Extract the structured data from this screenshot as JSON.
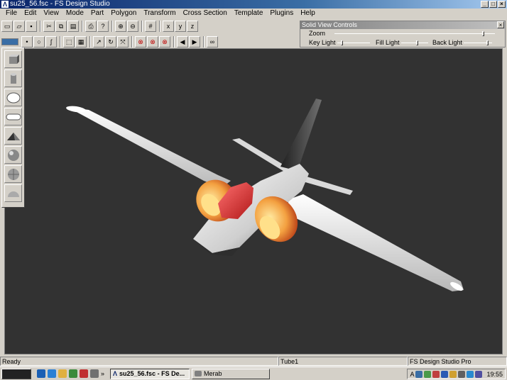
{
  "window": {
    "title": "su25_56.fsc - FS Design Studio",
    "min": "_",
    "max": "□",
    "close": "×"
  },
  "menu": [
    "File",
    "Edit",
    "View",
    "Mode",
    "Part",
    "Polygon",
    "Transform",
    "Cross Section",
    "Template",
    "Plugins",
    "Help"
  ],
  "solid_view": {
    "title": "Solid View Controls",
    "zoom_label": "Zoom",
    "key_light_label": "Key Light",
    "fill_light_label": "Fill Light",
    "back_light_label": "Back Light",
    "zoom_level": 0.93,
    "key_light_level": 0.15,
    "fill_light_level": 0.6,
    "back_light_level": 0.85
  },
  "toolbar1": [
    "new-icon",
    "open-icon",
    "save-icon",
    "cut-icon",
    "copy-icon",
    "paste-icon",
    "print-icon",
    "help-icon",
    "zoom-in-icon",
    "zoom-out-icon",
    "grid-icon",
    "axis-x-icon",
    "axis-y-icon",
    "axis-z-icon"
  ],
  "toolbar2": [
    "select-icon",
    "point-icon",
    "circle-icon",
    "curve-icon",
    "box-select-icon",
    "stamp-icon",
    "arrow-icon",
    "rotate-icon",
    "scale-icon",
    "delete-1-icon",
    "delete-2-icon",
    "delete-3-icon",
    "prev-icon",
    "next-icon",
    "binoculars-icon"
  ],
  "shapes": [
    "cube-icon",
    "cylinder-icon",
    "disk-icon",
    "capsule-icon",
    "pyramid-icon",
    "sphere-icon",
    "geosphere-icon",
    "hemisphere-icon"
  ],
  "status": {
    "left": "Ready",
    "part": "Tube1",
    "edition": "FS Design Studio Pro"
  },
  "taskbar": {
    "chevron": "»",
    "tasks": [
      {
        "label": "su25_56.fsc - FS De...",
        "active": true
      },
      {
        "label": "Merab",
        "active": false
      }
    ],
    "clock": "19:55",
    "tray_letter": "A"
  },
  "colors": {
    "viewport_bg": "#323232",
    "title_bar": "#0a246a",
    "canopy": "#e03030",
    "engine": "#f0a040"
  }
}
